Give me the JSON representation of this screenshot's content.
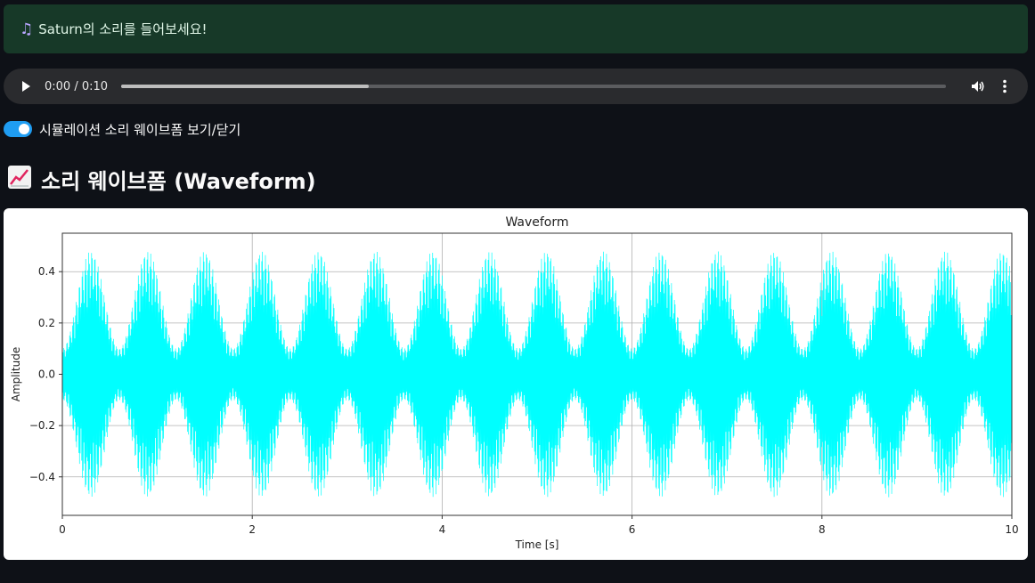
{
  "banner": {
    "text": "Saturn의 소리를 들어보세요!",
    "icon": "musical-note-icon"
  },
  "audio_player": {
    "time": "0:00 / 0:10",
    "buffered_fraction": 0.3
  },
  "toggle": {
    "label": "시뮬레이션 소리 웨이브폼 보기/닫기",
    "checked": true,
    "color": "#1f9df2"
  },
  "section": {
    "title": "소리 웨이브폼 (Waveform)",
    "icon": "chart-increasing-icon"
  },
  "chart_data": {
    "type": "line",
    "title": "Waveform",
    "xlabel": "Time [s]",
    "ylabel": "Amplitude",
    "xlim": [
      0,
      10
    ],
    "ylim": [
      -0.55,
      0.55
    ],
    "xticks": [
      0,
      2,
      4,
      6,
      8,
      10
    ],
    "xtick_labels": [
      "0",
      "2",
      "4",
      "6",
      "8",
      "10"
    ],
    "yticks": [
      -0.4,
      -0.2,
      0.0,
      0.2,
      0.4
    ],
    "ytick_labels": [
      "−0.4",
      "−0.2",
      "0.0",
      "0.2",
      "0.4"
    ],
    "grid": true,
    "line_color": "#00ffff",
    "signal": {
      "envelope_period_s": 0.6,
      "envelope_peak": 0.48,
      "envelope_trough": 0.1,
      "duration_s": 10
    }
  }
}
